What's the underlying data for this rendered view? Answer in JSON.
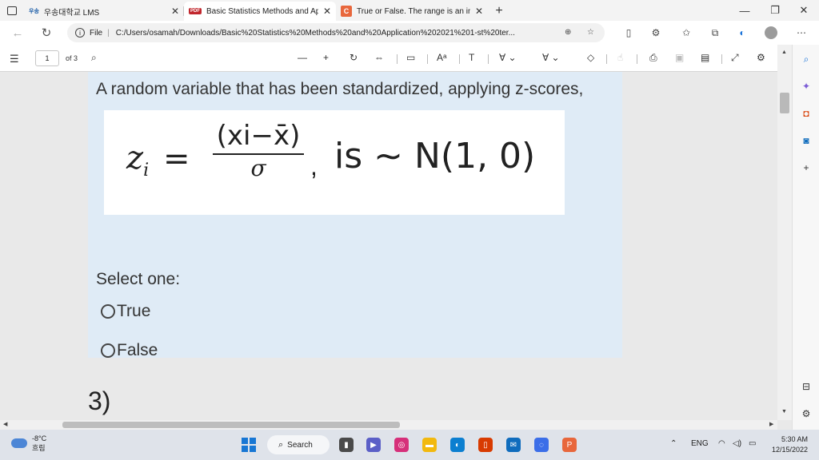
{
  "tabs": [
    {
      "favicon": "우송",
      "title": "우송대학교 LMS",
      "active": false
    },
    {
      "favicon": "PDF",
      "title": "Basic Statistics Methods and App",
      "active": true
    },
    {
      "favicon": "C",
      "title": "True or False. The range is an insi",
      "active": false
    }
  ],
  "address": {
    "protocol_label": "File",
    "url": "C:/Users/osamah/Downloads/Basic%20Statistics%20Methods%20and%20Application%202021%201-st%20ter..."
  },
  "pdf_toolbar": {
    "page_current": "1",
    "page_total": "of 3"
  },
  "question": {
    "text": "A random variable that has been standardized, applying z-scores,",
    "formula": {
      "lhs": "z",
      "lhs_sub": "i",
      "equals": "=",
      "numerator": "(xi−x̄)",
      "denominator": "σ",
      "comma": ",",
      "rest": "is ∼ N(1, 0)"
    },
    "select_label": "Select one:",
    "options": [
      "True",
      "False"
    ]
  },
  "next_question_number": "3)",
  "taskbar": {
    "temperature": "-8°C",
    "weather_label": "흐림",
    "search_label": "Search",
    "language": "ENG",
    "time": "5:30 AM",
    "date": "12/15/2022"
  },
  "colors": {
    "quiz_background": "#dfebf6",
    "taskbar_background": "#dfe3ea",
    "accent": "#1877d4"
  }
}
